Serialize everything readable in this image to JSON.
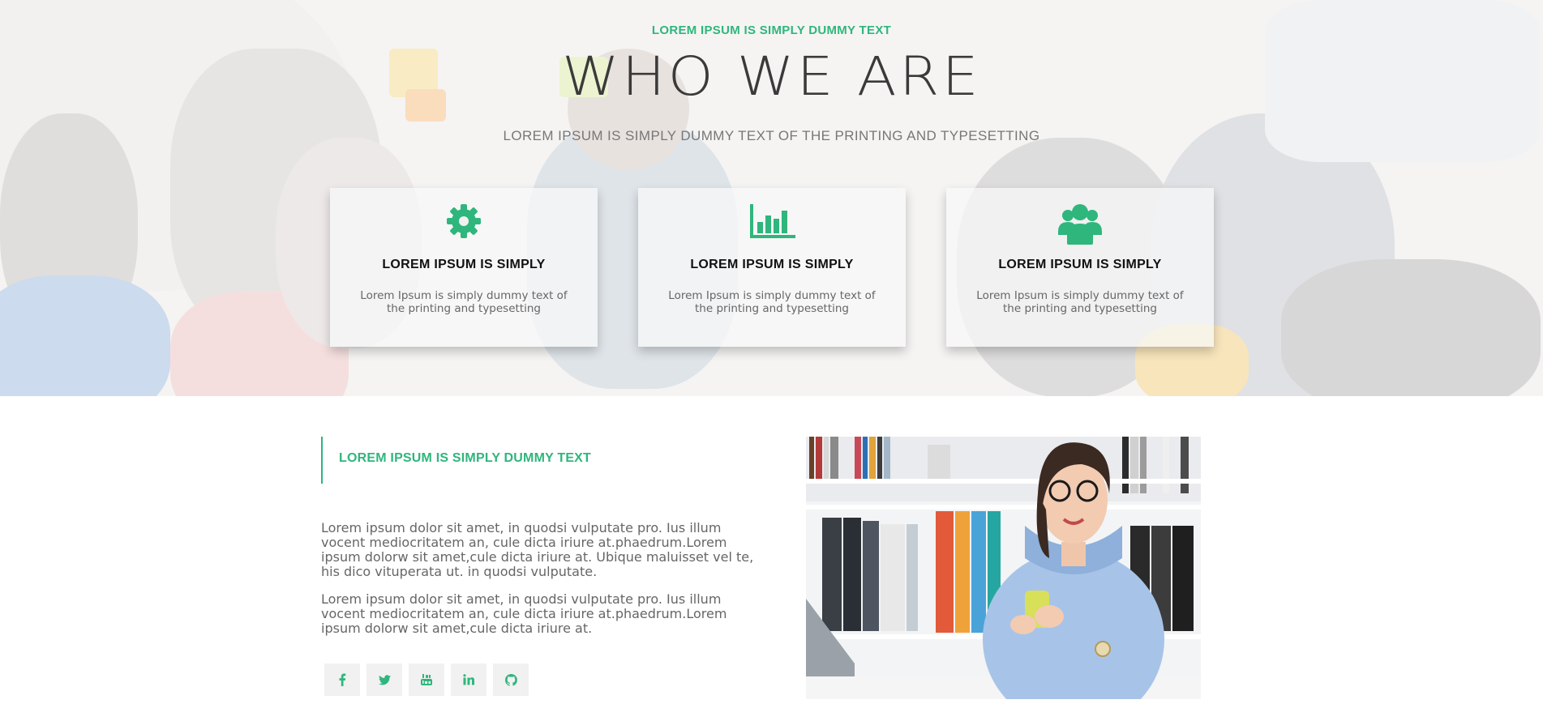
{
  "hero": {
    "eyebrow": "LOREM IPSUM IS SIMPLY DUMMY TEXT",
    "title": "WHO WE ARE",
    "subtitle": "LOREM IPSUM IS SIMPLY DUMMY TEXT OF THE PRINTING AND TYPESETTING"
  },
  "cards": [
    {
      "icon": "gear-icon",
      "title": "LOREM IPSUM IS SIMPLY",
      "text": "Lorem Ipsum is simply dummy text of the printing and typesetting"
    },
    {
      "icon": "bar-chart-icon",
      "title": "LOREM IPSUM IS SIMPLY",
      "text": "Lorem Ipsum is simply dummy text of the printing and typesetting"
    },
    {
      "icon": "users-icon",
      "title": "LOREM IPSUM IS SIMPLY",
      "text": "Lorem Ipsum is simply dummy text of the printing and typesetting"
    }
  ],
  "about": {
    "heading": "LOREM IPSUM IS SIMPLY DUMMY TEXT",
    "paragraph1": "Lorem ipsum dolor sit amet, in quodsi vulputate pro. Ius illum vocent mediocritatem an, cule dicta iriure at.phaedrum.Lorem ipsum dolorw sit amet,cule dicta iriure at. Ubique maluisset vel te, his dico vituperata ut. in quodsi vulputate.",
    "paragraph2": "Lorem ipsum dolor sit amet, in quodsi vulputate pro. Ius illum vocent mediocritatem an, cule dicta iriure at.phaedrum.Lorem ipsum dolorw sit amet,cule dicta iriure at."
  },
  "socials": [
    "facebook-icon",
    "twitter-icon",
    "youtube-icon",
    "linkedin-icon",
    "github-icon"
  ],
  "colors": {
    "accent": "#2fb67c",
    "title": "#3a3a3a",
    "body_text": "#666666",
    "social_bg": "#f1f1f1"
  }
}
